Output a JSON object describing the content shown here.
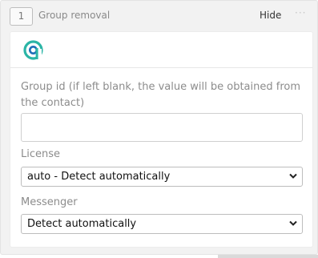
{
  "step": {
    "number": "1",
    "title": "Group removal",
    "hide_label": "Hide",
    "more_label": "···"
  },
  "form": {
    "group_id": {
      "label": "Group id (if left blank, the value will be obtained from the contact)",
      "value": "",
      "placeholder": ""
    },
    "license": {
      "label": "License",
      "selected": "auto - Detect automatically"
    },
    "messenger": {
      "label": "Messenger",
      "selected": "Detect automatically"
    }
  },
  "icons": {
    "logo": "app-logo-icon",
    "chevron": "chevron-down-icon",
    "more": "more-dots-icon"
  },
  "colors": {
    "logo_teal": "#2bb5a6",
    "logo_blue": "#1e6fb8",
    "panel_bg": "#f2f2f2"
  }
}
